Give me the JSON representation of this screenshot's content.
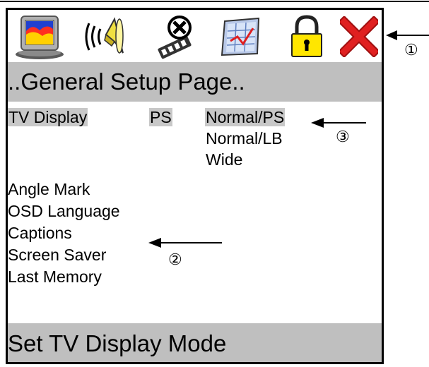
{
  "osd": {
    "icons": [
      {
        "name": "tv-display-icon"
      },
      {
        "name": "speaker-audio-icon"
      },
      {
        "name": "film-reel-icon"
      },
      {
        "name": "preference-chart-icon"
      },
      {
        "name": "padlock-icon"
      },
      {
        "name": "exit-x-icon"
      }
    ],
    "title": "..General Setup Page..",
    "settings": [
      {
        "label": "TV Display",
        "current_value": "PS",
        "highlighted": true
      },
      {
        "label": "Angle Mark"
      },
      {
        "label": "OSD Language"
      },
      {
        "label": "Captions"
      },
      {
        "label": "Screen Saver"
      },
      {
        "label": "Last Memory"
      }
    ],
    "submenu_options": [
      {
        "label": "Normal/PS",
        "highlighted": true
      },
      {
        "label": "Normal/LB"
      },
      {
        "label": "Wide"
      }
    ],
    "status_text": "Set TV Display Mode",
    "colors": {
      "bar_gray": "#bfbfbf",
      "highlight_gray": "#c8c8c8",
      "exit_red": "#e02020",
      "lock_yellow": "#ffe600"
    }
  },
  "callouts": [
    {
      "number": "①"
    },
    {
      "number": "②"
    },
    {
      "number": "③"
    }
  ]
}
